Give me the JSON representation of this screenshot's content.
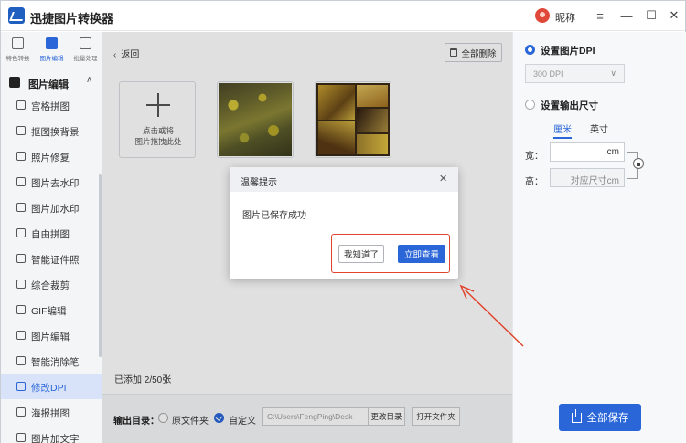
{
  "titlebar": {
    "app_title": "迅捷图片转换器",
    "user_name": "昵称",
    "menu_icon": "≡",
    "min_icon": "—",
    "max_icon": "☐",
    "close_icon": "✕"
  },
  "sidebar": {
    "top_tabs": [
      {
        "label": "特色转换"
      },
      {
        "label": "图片编辑"
      },
      {
        "label": "批量处理"
      }
    ],
    "section_label": "图片编辑",
    "section_chevron": "∧",
    "items": [
      {
        "label": "宫格拼图"
      },
      {
        "label": "抠图换背景"
      },
      {
        "label": "照片修复"
      },
      {
        "label": "图片去水印"
      },
      {
        "label": "图片加水印"
      },
      {
        "label": "自由拼图"
      },
      {
        "label": "智能证件照"
      },
      {
        "label": "综合裁剪"
      },
      {
        "label": "GIF编辑"
      },
      {
        "label": "图片编辑"
      },
      {
        "label": "智能消除笔"
      },
      {
        "label": "修改DPI"
      },
      {
        "label": "海报拼图"
      },
      {
        "label": "图片加文字"
      }
    ]
  },
  "main": {
    "back_label": "返回",
    "back_icon": "‹",
    "delete_all_label": "全部删除",
    "upload_hint_line1": "点击或将",
    "upload_hint_line2": "图片拖拽此处",
    "added_count": "已添加 2/50张",
    "output": {
      "label": "输出目录：",
      "option_source": "原文件夹",
      "option_custom": "自定义",
      "path_value": "C:\\Users\\FengPing\\Desk",
      "change_dir_label": "更改目录",
      "open_folder_label": "打开文件夹"
    }
  },
  "right_panel": {
    "dpi_label": "设置图片DPI",
    "dpi_value": "300 DPI",
    "dpi_chevron": "∨",
    "size_label": "设置输出尺寸",
    "unit_cm": "厘米",
    "unit_inch": "英寸",
    "width_label": "宽：",
    "height_label": "高：",
    "width_value": "cm",
    "height_value": "对应尺寸cm",
    "save_all_label": "全部保存"
  },
  "dialog": {
    "title": "温馨提示",
    "close_icon": "✕",
    "message": "图片已保存成功",
    "dismiss_label": "我知道了",
    "view_label": "立即查看"
  },
  "colors": {
    "accent": "#2a66d8",
    "annotation": "#e0442c"
  }
}
